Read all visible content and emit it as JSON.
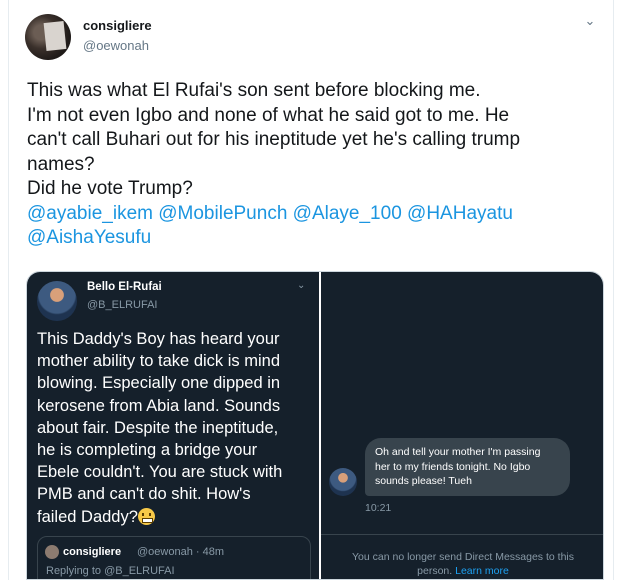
{
  "tweet": {
    "author_name": "consigliere",
    "author_handle": "@oewonah",
    "text_lines": [
      "This was what El Rufai's son sent before blocking me.",
      "I'm not even Igbo and none of what he said got to me. He",
      "can't call Buhari out for his ineptitude yet he's calling trump",
      "names?",
      "Did he vote Trump?"
    ],
    "mentions_line1": [
      "@ayabie_ikem",
      "@MobilePunch",
      "@Alaye_100",
      "@HAHayatu"
    ],
    "mentions_line2": [
      "@AishaYesufu"
    ]
  },
  "screenshot_left": {
    "author_name": "Bello El-Rufai",
    "author_handle": "@B_ELRUFAI",
    "text_lines": [
      "This Daddy's Boy has heard your",
      "mother ability to take dick is mind",
      "blowing. Especially one dipped in",
      "kerosene from Abia land. Sounds",
      "about fair. Despite the ineptitude,",
      "he is completing a bridge your",
      "Ebele couldn't. You are stuck with",
      "PMB and can't do shit. How's",
      "failed Daddy?"
    ],
    "quote_name": "consigliere",
    "quote_handle": "@oewonah · 48m",
    "quote_reply": "Replying to @B_ELRUFAI"
  },
  "screenshot_right": {
    "message_lines": [
      "Oh and tell your mother I'm passing",
      "her to my friends tonight. No Igbo",
      "sounds please! Tueh"
    ],
    "time": "10:21",
    "notice_line1": "You can no longer send Direct Messages to this",
    "notice_line2_prefix": "person. ",
    "notice_link": "Learn more"
  },
  "icons": [
    "chevron-down-icon",
    "grimacing-emoji-icon"
  ],
  "colors": {
    "link": "#1b95e0",
    "dark_bg": "#15202b",
    "bubble": "#38444d"
  }
}
